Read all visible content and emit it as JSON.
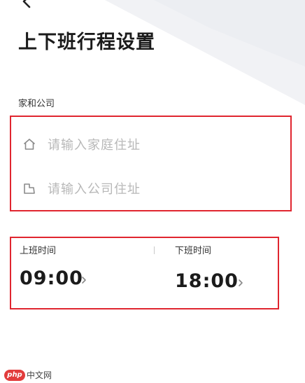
{
  "page": {
    "title": "上下班行程设置",
    "back_icon": "chevron-left-icon"
  },
  "home_company": {
    "section_label": "家和公司",
    "home": {
      "placeholder": "请输入家庭住址",
      "icon": "home-icon"
    },
    "company": {
      "placeholder": "请输入公司住址",
      "icon": "building-icon"
    }
  },
  "commute_times": {
    "start": {
      "label": "上班时间",
      "value": "09:00",
      "icon": "chevron-right-icon"
    },
    "end": {
      "label": "下班时间",
      "value": "18:00",
      "icon": "chevron-right-icon"
    }
  },
  "watermark": {
    "logo": "php",
    "text": "中文网"
  },
  "colors": {
    "highlight_border": "#e0252f",
    "placeholder": "#b8b8b8",
    "title": "#1b1b1b"
  }
}
